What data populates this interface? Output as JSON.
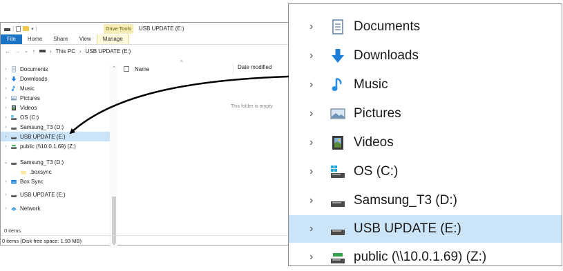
{
  "titlebar": {
    "contextual_tab": "Drive Tools",
    "window_title": "USB UPDATE (E:)"
  },
  "ribbon": {
    "tabs": [
      "File",
      "Home",
      "Share",
      "View",
      "Manage"
    ]
  },
  "address": {
    "breadcrumb_root": "This PC",
    "breadcrumb_separator": "›",
    "breadcrumb_current": "USB UPDATE (E:)"
  },
  "nav_pane": {
    "items": [
      {
        "label": "Documents",
        "icon": "documents-icon",
        "chevron": "›"
      },
      {
        "label": "Downloads",
        "icon": "downloads-icon",
        "chevron": "›"
      },
      {
        "label": "Music",
        "icon": "music-icon",
        "chevron": "›"
      },
      {
        "label": "Pictures",
        "icon": "pictures-icon",
        "chevron": "›"
      },
      {
        "label": "Videos",
        "icon": "videos-icon",
        "chevron": "›"
      },
      {
        "label": "OS (C:)",
        "icon": "os-drive-icon",
        "chevron": "›"
      },
      {
        "label": "Samsung_T3 (D:)",
        "icon": "drive-icon",
        "chevron": "›"
      },
      {
        "label": "USB UPDATE (E:)",
        "icon": "drive-icon",
        "chevron": "›",
        "selected": true
      },
      {
        "label": "public (\\\\10.0.1.69) (Z:)",
        "icon": "network-drive-icon",
        "chevron": "›"
      },
      {
        "label": "Samsung_T3 (D:)",
        "icon": "drive-icon",
        "chevron": "⌄"
      },
      {
        "label": ".boxsync",
        "icon": "folder-icon",
        "chevron": ""
      },
      {
        "label": "Box Sync",
        "icon": "box-sync-icon",
        "chevron": "›"
      },
      {
        "label": "USB UPDATE (E:)",
        "icon": "drive-icon",
        "chevron": "›"
      },
      {
        "label": "Network",
        "icon": "network-icon",
        "chevron": "›"
      }
    ]
  },
  "file_list": {
    "columns": [
      "Name",
      "Date modified"
    ],
    "empty_message": "This folder is empty."
  },
  "status": {
    "item_count": "0 items",
    "status_bar_text": "0 items (Disk free space: 1.93 MB)"
  },
  "zoom_panel": {
    "items": [
      {
        "label": "Documents",
        "icon": "documents-icon"
      },
      {
        "label": "Downloads",
        "icon": "downloads-icon"
      },
      {
        "label": "Music",
        "icon": "music-icon"
      },
      {
        "label": "Pictures",
        "icon": "pictures-icon"
      },
      {
        "label": "Videos",
        "icon": "videos-icon"
      },
      {
        "label": "OS (C:)",
        "icon": "os-drive-icon"
      },
      {
        "label": "Samsung_T3 (D:)",
        "icon": "drive-icon"
      },
      {
        "label": "USB UPDATE (E:)",
        "icon": "drive-icon",
        "selected": true
      },
      {
        "label": "public (\\\\10.0.1.69) (Z:)",
        "icon": "network-drive-icon"
      }
    ],
    "chevron": "›"
  },
  "colors": {
    "selection": "#cce4f7",
    "file_tab": "#1a73c5",
    "drive_tools": "#f6ecb6",
    "downloads_blue": "#1e7fd8",
    "music_blue": "#2b8de0"
  }
}
